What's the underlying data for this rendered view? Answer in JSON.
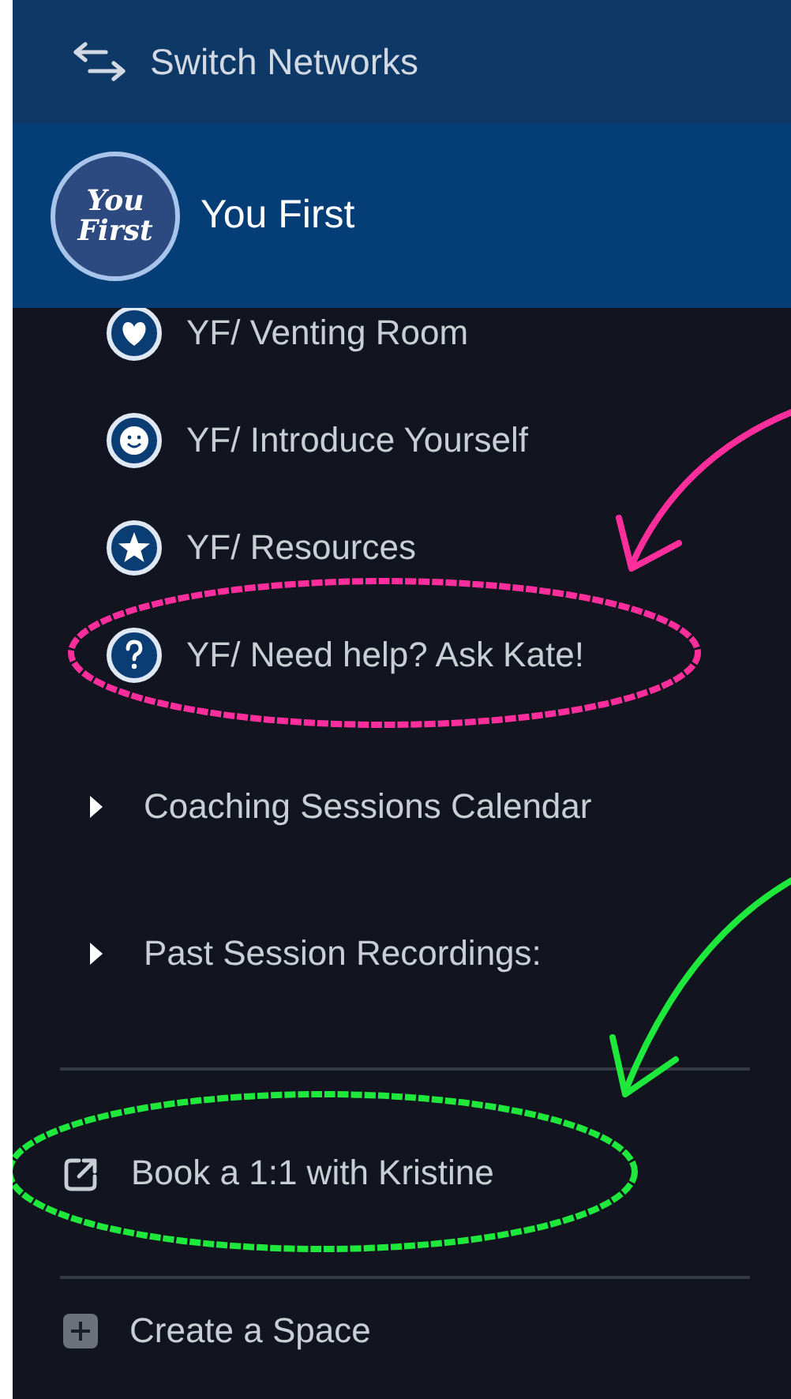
{
  "top_bar": {
    "label": "Switch Networks"
  },
  "network": {
    "name": "You First",
    "logo": [
      "You",
      "First"
    ]
  },
  "channels": [
    {
      "label": "YF/ Venting Room"
    },
    {
      "label": "YF/ Introduce Yourself"
    },
    {
      "label": "YF/ Resources"
    },
    {
      "label": "YF/ Need help? Ask Kate!",
      "annotation": {
        "color": "#ff2e9c"
      }
    }
  ],
  "sections": [
    {
      "label": "Coaching Sessions Calendar",
      "expanded": false
    },
    {
      "label": "Past Session Recordings:",
      "expanded": false
    }
  ],
  "links": [
    {
      "label": "Book a 1:1 with Kristine",
      "annotation": {
        "color": "#1fe83c"
      }
    }
  ],
  "actions": [
    {
      "label": "Create a Space"
    }
  ]
}
